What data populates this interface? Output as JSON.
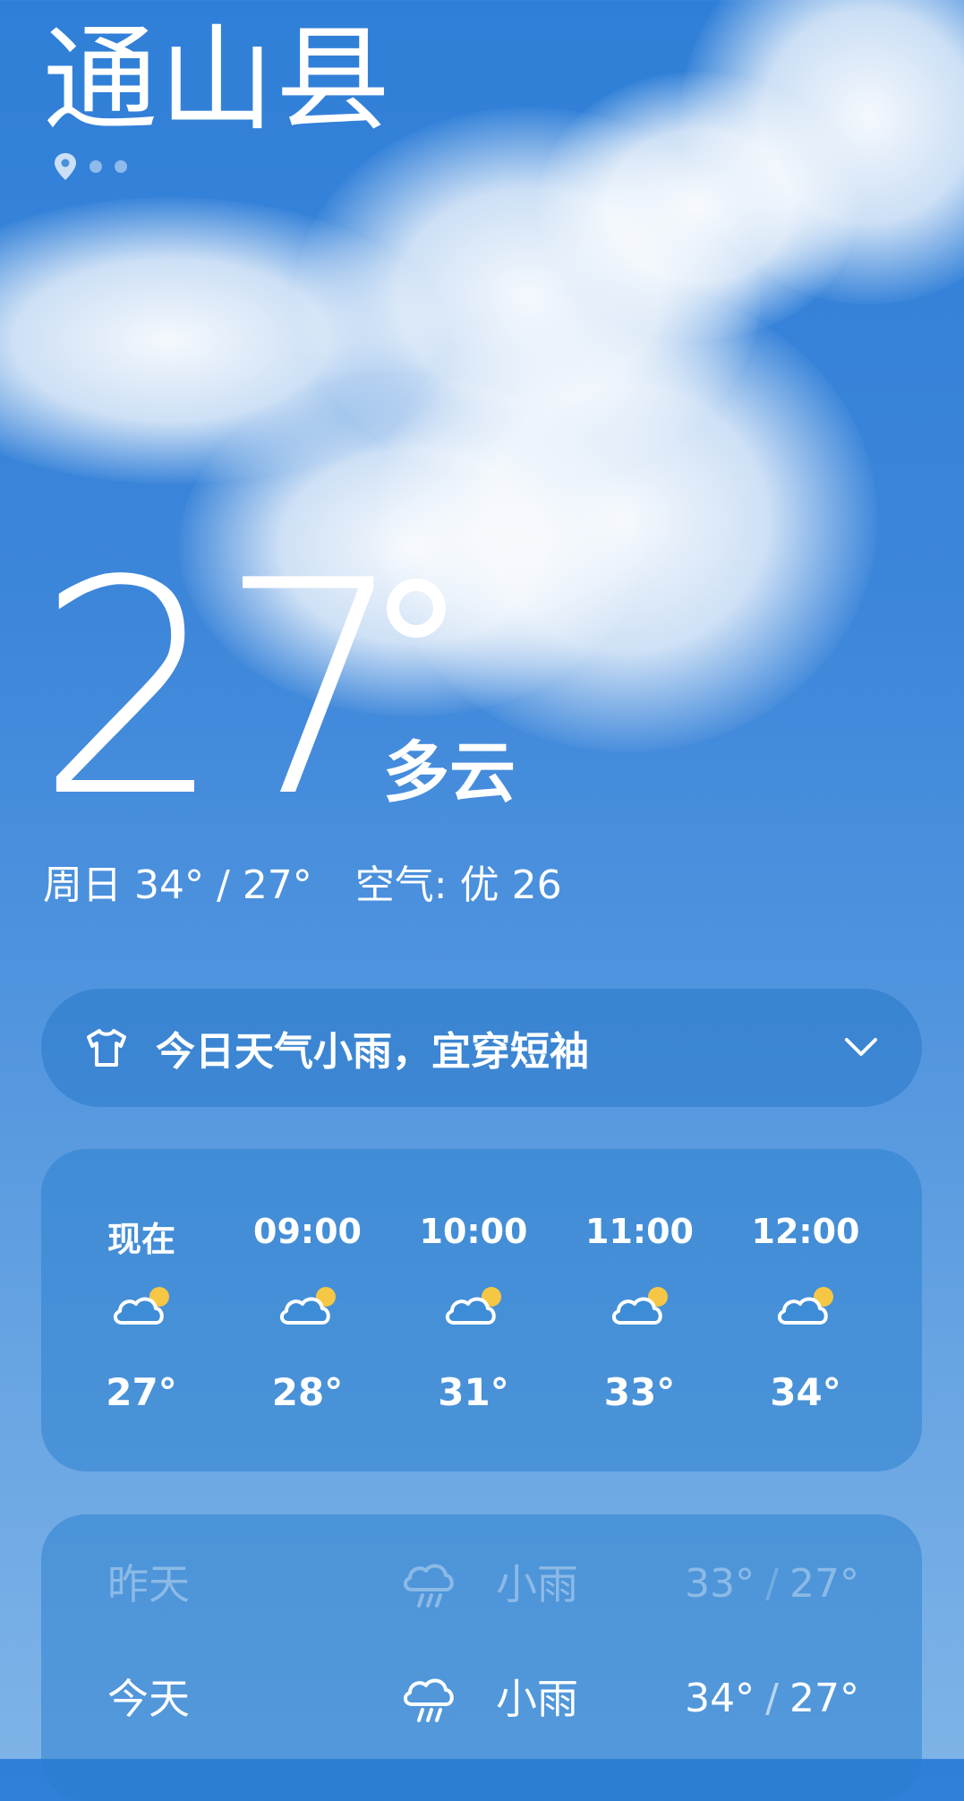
{
  "location": {
    "city": "通山县"
  },
  "current": {
    "temperature": "27",
    "condition": "多云"
  },
  "today_summary": {
    "day": "周日",
    "high": "34°",
    "low": "27°",
    "air_label": "空气:",
    "air_value": "优 26"
  },
  "tip": {
    "text": "今日天气小雨，宜穿短袖",
    "icon": "shirt-icon"
  },
  "hourly": [
    {
      "time": "现在",
      "temp": "27°",
      "icon": "partly-cloudy-icon"
    },
    {
      "time": "09:00",
      "temp": "28°",
      "icon": "partly-cloudy-icon"
    },
    {
      "time": "10:00",
      "temp": "31°",
      "icon": "partly-cloudy-icon"
    },
    {
      "time": "11:00",
      "temp": "33°",
      "icon": "partly-cloudy-icon"
    },
    {
      "time": "12:00",
      "temp": "34°",
      "icon": "partly-cloudy-icon"
    }
  ],
  "daily": [
    {
      "day": "昨天",
      "condition": "小雨",
      "high": "33°",
      "low": "27°",
      "icon": "light-rain-icon"
    },
    {
      "day": "今天",
      "condition": "小雨",
      "high": "34°",
      "low": "27°",
      "icon": "light-rain-icon"
    }
  ],
  "colors": {
    "sun": "#f6c744",
    "card": "#2f7dcb",
    "text": "#ffffff"
  }
}
